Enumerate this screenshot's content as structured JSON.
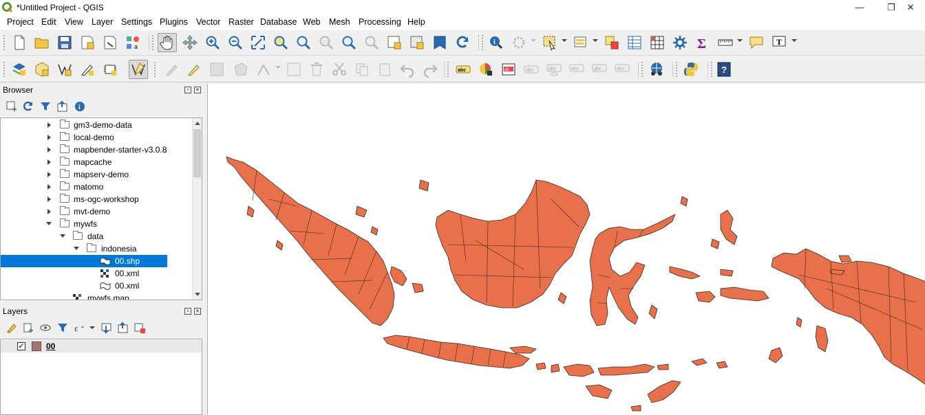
{
  "window": {
    "title": "*Untitled Project - QGIS",
    "minimize": "—",
    "maximize": "❐",
    "close": "✕"
  },
  "menu": [
    "Project",
    "Edit",
    "View",
    "Layer",
    "Settings",
    "Plugins",
    "Vector",
    "Raster",
    "Database",
    "Web",
    "Mesh",
    "Processing",
    "Help"
  ],
  "browser": {
    "title": "Browser",
    "items": [
      {
        "label": "gm3-demo-data",
        "kind": "folder",
        "expanded": false
      },
      {
        "label": "local-demo",
        "kind": "folder",
        "expanded": false
      },
      {
        "label": "mapbender-starter-v3.0.8",
        "kind": "folder",
        "expanded": false
      },
      {
        "label": "mapcache",
        "kind": "folder",
        "expanded": false
      },
      {
        "label": "mapserv-demo",
        "kind": "folder",
        "expanded": false
      },
      {
        "label": "matomo",
        "kind": "folder",
        "expanded": false
      },
      {
        "label": "ms-ogc-workshop",
        "kind": "folder",
        "expanded": false
      },
      {
        "label": "mvt-demo",
        "kind": "folder",
        "expanded": false
      },
      {
        "label": "mywfs",
        "kind": "folder",
        "expanded": true
      },
      {
        "label": "data",
        "kind": "folder",
        "expanded": true
      },
      {
        "label": "indonesia",
        "kind": "folder",
        "expanded": true
      },
      {
        "label": "00.shp",
        "kind": "vector",
        "selected": true
      },
      {
        "label": "00.xml",
        "kind": "raster"
      },
      {
        "label": "00.xml",
        "kind": "vector"
      },
      {
        "label": "mywfs.map",
        "kind": "raster"
      }
    ]
  },
  "layers": {
    "title": "Layers",
    "items": [
      {
        "name": "00",
        "checked": true,
        "color": "#a87272"
      }
    ]
  },
  "map": {
    "fill_color": "#e8704a",
    "stroke_color": "#3a2a22",
    "background": "#ffffff"
  }
}
